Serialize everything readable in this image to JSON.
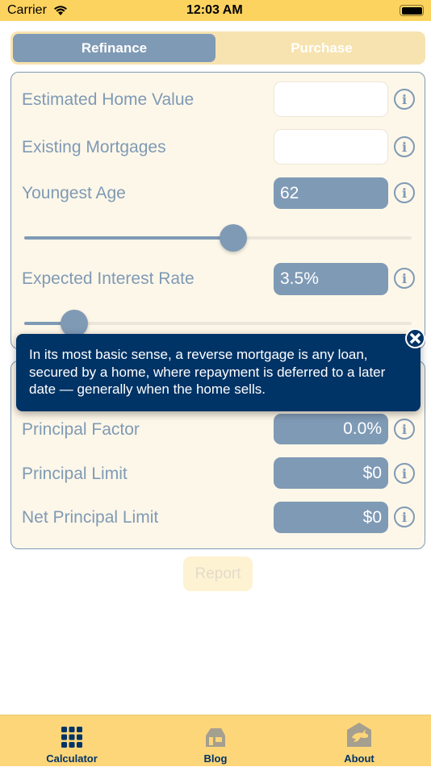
{
  "status_bar": {
    "carrier": "Carrier",
    "time": "12:03 AM"
  },
  "segment": {
    "options": [
      "Refinance",
      "Purchase"
    ],
    "selected": "Refinance"
  },
  "inputs": {
    "home_value": {
      "label": "Estimated Home Value",
      "value": ""
    },
    "mortgages": {
      "label": "Existing Mortgages",
      "value": ""
    },
    "age": {
      "label": "Youngest Age",
      "value": "62",
      "slider_fraction": 0.54
    },
    "rate": {
      "label": "Expected Interest Rate",
      "value": "3.5%",
      "slider_fraction": 0.13
    }
  },
  "results": {
    "principal_factor": {
      "label": "Principal Factor",
      "value": "0.0%"
    },
    "principal_limit": {
      "label": "Principal Limit",
      "value": "$0"
    },
    "net_principal_limit": {
      "label": "Net Principal Limit",
      "value": "$0"
    }
  },
  "tooltip": {
    "text": "In its most basic sense, a reverse mortgage is any loan, secured by a home, where repayment is deferred to a later date — generally when the home sells."
  },
  "report_label": "Report",
  "tabs": [
    {
      "label": "Calculator",
      "icon": "grid-icon",
      "active": true
    },
    {
      "label": "Blog",
      "icon": "house-icon"
    },
    {
      "label": "About",
      "icon": "rabbit-house-icon"
    }
  ],
  "colors": {
    "accent": "#7f9ab5",
    "navy": "#003366",
    "tabbar": "#fdd67a"
  }
}
